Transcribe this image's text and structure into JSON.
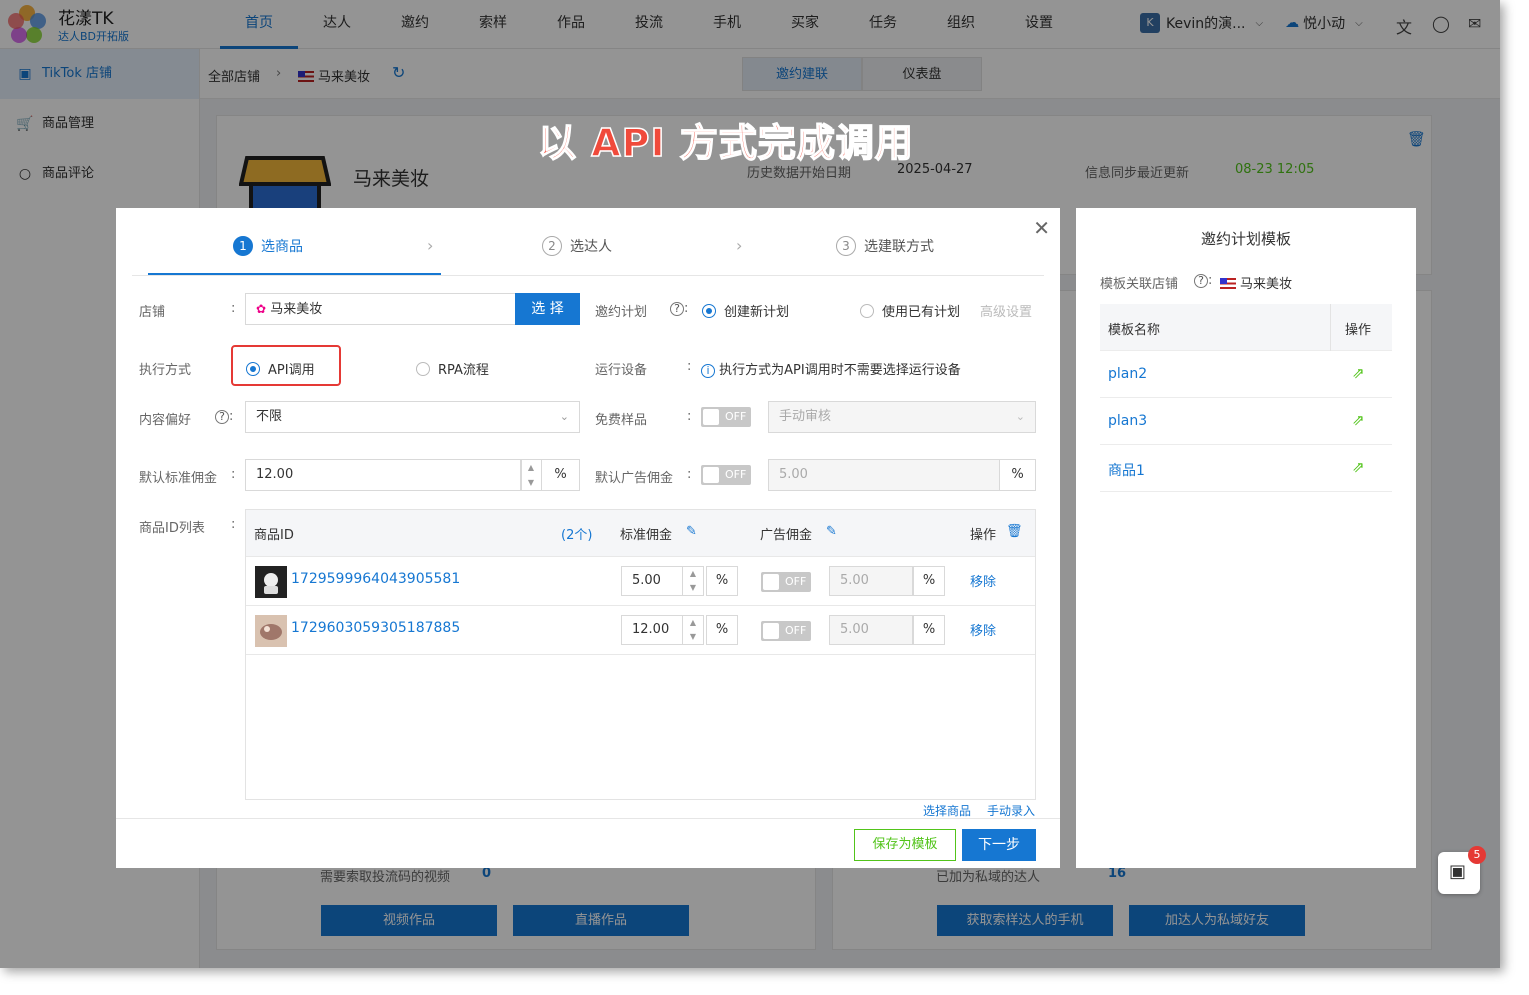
{
  "app": {
    "title": "花漾TK",
    "subtitle": "达人BD开拓版"
  },
  "nav": [
    "首页",
    "达人",
    "邀约",
    "索样",
    "作品",
    "投流",
    "手机",
    "买家",
    "任务",
    "组织",
    "设置"
  ],
  "user": {
    "avatar": "K",
    "name": "Kevin的演...",
    "workspace": "悦小动"
  },
  "sidebar": [
    "TikTok 店铺",
    "商品管理",
    "商品评论"
  ],
  "breadcrumb": {
    "root": "全部店铺",
    "shop": "马来美妆"
  },
  "view_tabs": [
    "邀约建联",
    "仪表盘"
  ],
  "shop_card": {
    "name": "马来美妆",
    "history_label": "历史数据开始日期",
    "history_date": "2025-04-27",
    "sync_label": "信息同步最近更新",
    "sync_time": "08-23 12:05"
  },
  "background": {
    "video_label": "需要索取投流码的视频",
    "video_count": "0",
    "private_label": "已加为私域的达人",
    "private_count": "16",
    "btn_video": "视频作品",
    "btn_live": "直播作品",
    "btn_phone": "获取索样达人的手机",
    "btn_private": "加达人为私域好友"
  },
  "annotation": "以 API 方式完成调用",
  "steps": [
    {
      "num": "1",
      "label": "选商品"
    },
    {
      "num": "2",
      "label": "选达人"
    },
    {
      "num": "3",
      "label": "选建联方式"
    }
  ],
  "form": {
    "shop_label": "店铺",
    "shop_value": "马来美妆",
    "select_btn": "选 择",
    "plan_label": "邀约计划",
    "plan_new": "创建新计划",
    "plan_existing": "使用已有计划",
    "advanced": "高级设置",
    "exec_label": "执行方式",
    "exec_api": "API调用",
    "exec_rpa": "RPA流程",
    "device_label": "运行设备",
    "device_hint": "执行方式为API调用时不需要选择运行设备",
    "content_label": "内容偏好",
    "content_value": "不限",
    "free_sample_label": "免费样品",
    "free_sample_toggle": "OFF",
    "free_sample_value": "手动审核",
    "std_comm_label": "默认标准佣金",
    "std_comm_value": "12.00",
    "pct": "%",
    "ad_comm_label": "默认广告佣金",
    "ad_comm_toggle": "OFF",
    "ad_comm_value": "5.00",
    "ids_label": "商品ID列表"
  },
  "table": {
    "headers": {
      "id": "商品ID",
      "count": "(2个)",
      "std": "标准佣金",
      "ad": "广告佣金",
      "op": "操作"
    },
    "rows": [
      {
        "id": "1729599964043905581",
        "std": "5.00",
        "ad_toggle": "OFF",
        "ad": "5.00",
        "action": "移除"
      },
      {
        "id": "1729603059305187885",
        "std": "12.00",
        "ad_toggle": "OFF",
        "ad": "5.00",
        "action": "移除"
      }
    ],
    "select_goods": "选择商品",
    "manual_entry": "手动录入"
  },
  "footer": {
    "save_template": "保存为模板",
    "next": "下一步"
  },
  "template_panel": {
    "title": "邀约计划模板",
    "shop_label": "模板关联店铺",
    "shop_value": "马来美妆",
    "col_name": "模板名称",
    "col_op": "操作",
    "items": [
      "plan2",
      "plan3",
      "商品1"
    ]
  },
  "fab_badge": "5",
  "colors": {
    "primary": "#1677d2",
    "success": "#52c41a",
    "highlight": "#e53935"
  }
}
